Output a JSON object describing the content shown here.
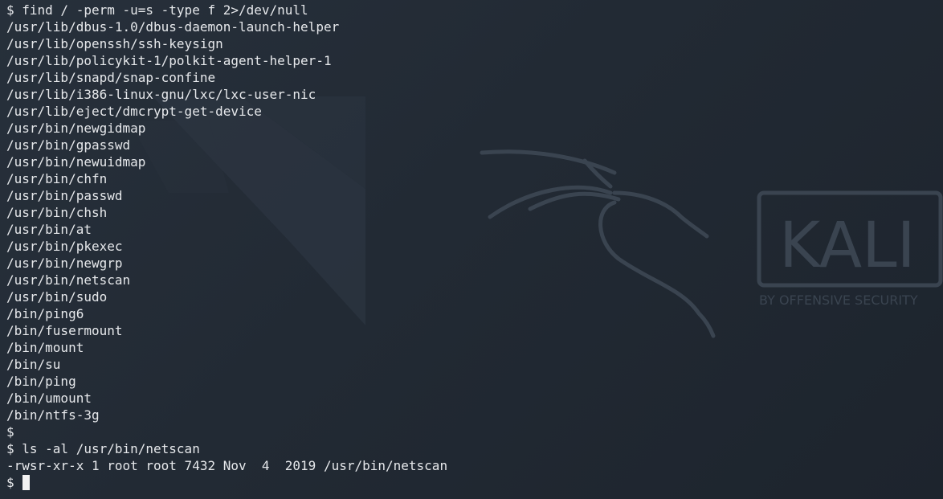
{
  "terminal": {
    "lines": [
      "$ find / -perm -u=s -type f 2>/dev/null",
      "/usr/lib/dbus-1.0/dbus-daemon-launch-helper",
      "/usr/lib/openssh/ssh-keysign",
      "/usr/lib/policykit-1/polkit-agent-helper-1",
      "/usr/lib/snapd/snap-confine",
      "/usr/lib/i386-linux-gnu/lxc/lxc-user-nic",
      "/usr/lib/eject/dmcrypt-get-device",
      "/usr/bin/newgidmap",
      "/usr/bin/gpasswd",
      "/usr/bin/newuidmap",
      "/usr/bin/chfn",
      "/usr/bin/passwd",
      "/usr/bin/chsh",
      "/usr/bin/at",
      "/usr/bin/pkexec",
      "/usr/bin/newgrp",
      "/usr/bin/netscan",
      "/usr/bin/sudo",
      "/bin/ping6",
      "/bin/fusermount",
      "/bin/mount",
      "/bin/su",
      "/bin/ping",
      "/bin/umount",
      "/bin/ntfs-3g",
      "$",
      "$ ls -al /usr/bin/netscan",
      "-rwsr-xr-x 1 root root 7432 Nov  4  2019 /usr/bin/netscan"
    ],
    "prompt": "$ "
  },
  "wallpaper": {
    "logo_text": "KALI",
    "tagline": "BY OFFENSIVE SECURITY",
    "icon": "kali-dragon-icon"
  },
  "colors": {
    "background": "#222a34",
    "text": "#e6e8eb",
    "cursor": "#f2f2f2",
    "watermark": "#3a4450"
  }
}
